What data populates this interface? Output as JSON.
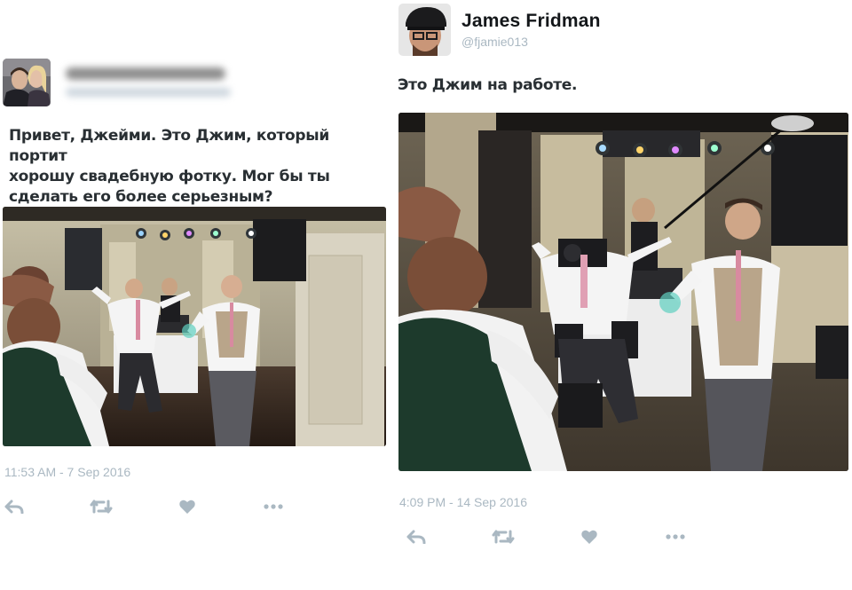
{
  "colors": {
    "text": "#292f33",
    "muted": "#aab8c2",
    "action_icon": "#aab8c2"
  },
  "left_tweet": {
    "avatar": "avatar-couple-photo",
    "author_name": "",
    "author_handle": "",
    "text_lines": [
      "Привет, Джейми. Это Джим, который портит",
      "хорошу свадебную фотку. Мог бы ты",
      "сделать его более серьезным?"
    ],
    "photo": "wedding-dance-photo",
    "timestamp": "11:53 AM - 7 Sep 2016",
    "actions": [
      "reply-icon",
      "retweet-icon",
      "like-icon",
      "more-icon"
    ]
  },
  "right_tweet": {
    "avatar": "avatar-james-fridman",
    "author_name": "James Fridman",
    "author_handle": "@fjamie013",
    "text": "Это Джим на работе.",
    "photo": "wedding-cameraman-photo",
    "timestamp": "4:09 PM - 14 Sep 2016",
    "actions": [
      "reply-icon",
      "retweet-icon",
      "like-icon",
      "more-icon"
    ]
  }
}
